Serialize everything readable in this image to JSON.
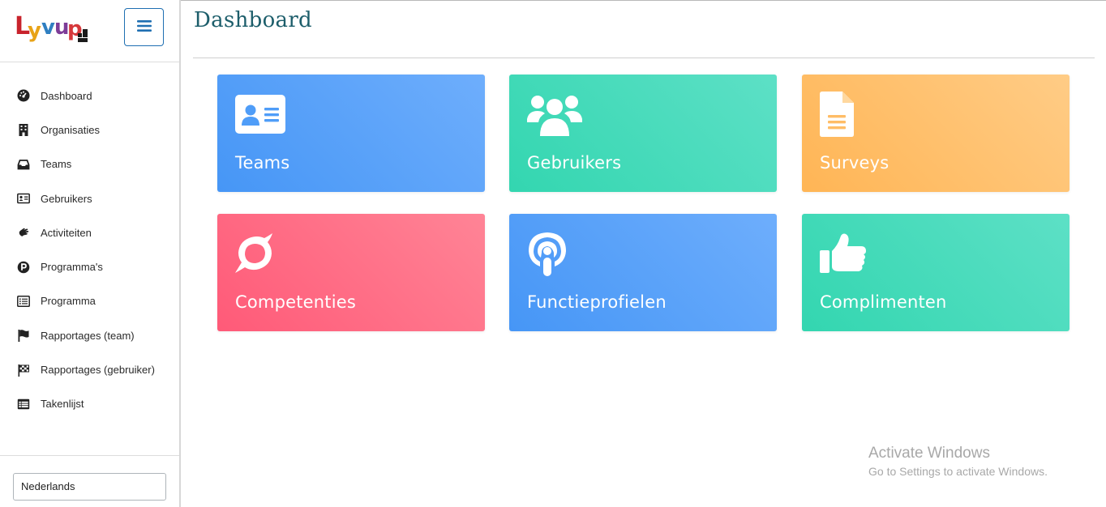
{
  "app": {
    "logo_text": "Lyvup"
  },
  "sidebar": {
    "menu_toggle_icon": "bars-icon",
    "items": [
      {
        "label": "Dashboard",
        "icon": "tachometer-icon"
      },
      {
        "label": "Organisaties",
        "icon": "building-icon"
      },
      {
        "label": "Teams",
        "icon": "inbox-icon"
      },
      {
        "label": "Gebruikers",
        "icon": "id-card-icon"
      },
      {
        "label": "Activiteiten",
        "icon": "hand-icon"
      },
      {
        "label": "Programma's",
        "icon": "parking-circle-icon"
      },
      {
        "label": "Programma",
        "icon": "list-alt-icon"
      },
      {
        "label": "Rapportages (team)",
        "icon": "flag-icon"
      },
      {
        "label": "Rapportages (gebruiker)",
        "icon": "checkered-flag-icon"
      },
      {
        "label": "Takenlijst",
        "icon": "table-list-icon"
      }
    ],
    "language": {
      "selected": "Nederlands"
    }
  },
  "main": {
    "title": "Dashboard",
    "tiles": [
      {
        "label": "Teams",
        "icon": "address-card-icon",
        "color": "#4f9df8"
      },
      {
        "label": "Gebruikers",
        "icon": "users-icon",
        "color": "#3dd9b4"
      },
      {
        "label": "Surveys",
        "icon": "file-text-icon",
        "color": "#ffbd66"
      },
      {
        "label": "Competenties",
        "icon": "meteor-icon",
        "color": "#ff6a84"
      },
      {
        "label": "Functieprofielen",
        "icon": "podcast-icon",
        "color": "#4f9df8"
      },
      {
        "label": "Complimenten",
        "icon": "thumbs-up-icon",
        "color": "#3dd9b4"
      }
    ]
  },
  "watermark": {
    "title": "Activate Windows",
    "subtitle": "Go to Settings to activate Windows."
  }
}
